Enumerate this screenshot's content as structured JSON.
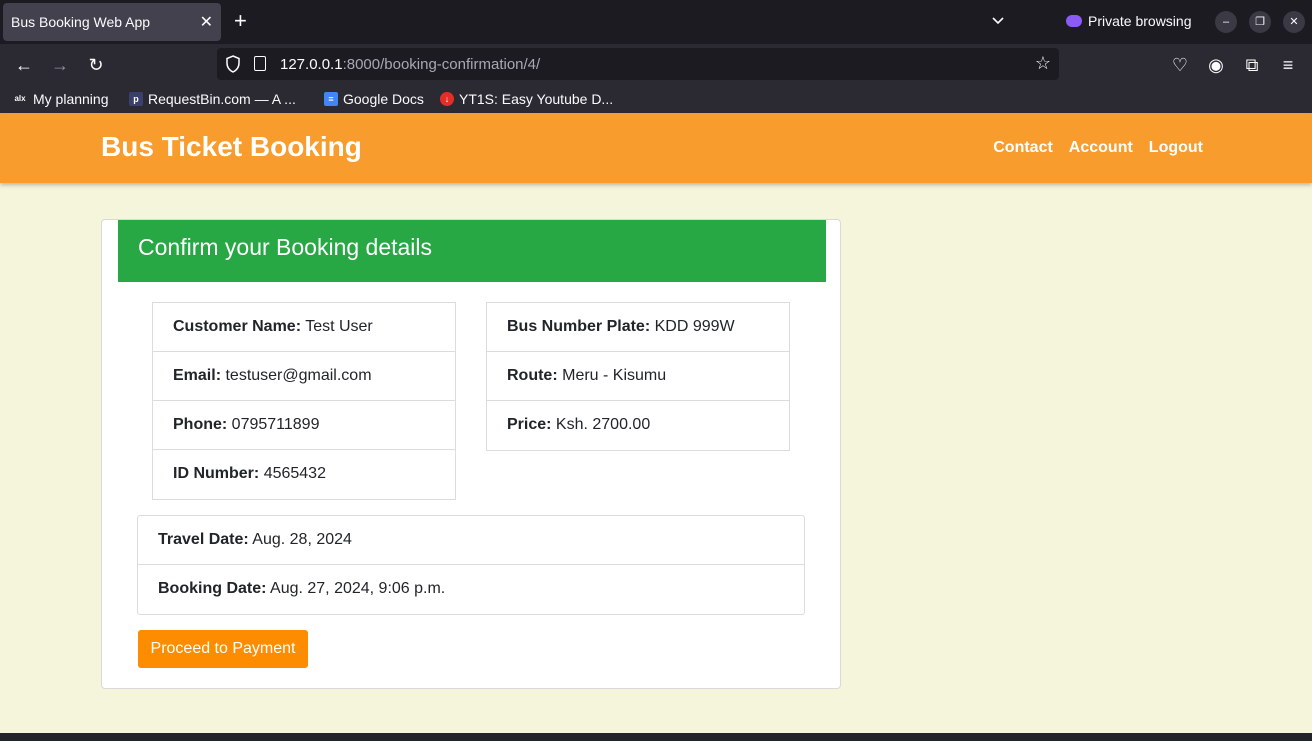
{
  "browser": {
    "tab_title": "Bus Booking Web App",
    "private_label": "Private browsing",
    "url_host": "127.0.0.1",
    "url_path": ":8000/booking-confirmation/4/",
    "bookmarks": [
      {
        "label": "My planning",
        "icon": "alx-icon"
      },
      {
        "label": "RequestBin.com — A ...",
        "icon": "requestbin-icon"
      },
      {
        "label": "Google Docs",
        "icon": "google-docs-icon"
      },
      {
        "label": "YT1S: Easy Youtube D...",
        "icon": "yt1s-icon"
      }
    ]
  },
  "site": {
    "brand": "Bus Ticket Booking",
    "nav": [
      "Contact",
      "Account",
      "Logout"
    ],
    "header_color": "#f89c2e"
  },
  "card": {
    "title": "Confirm your Booking details",
    "customer": [
      {
        "label": "Customer Name:",
        "value": "Test User"
      },
      {
        "label": "Email:",
        "value": "testuser@gmail.com"
      },
      {
        "label": "Phone:",
        "value": "0795711899"
      },
      {
        "label": "ID Number:",
        "value": "4565432"
      }
    ],
    "bus": [
      {
        "label": "Bus Number Plate:",
        "value": "KDD 999W"
      },
      {
        "label": "Route:",
        "value": "Meru - Kisumu"
      },
      {
        "label": "Price:",
        "value": "Ksh. 2700.00"
      }
    ],
    "dates": [
      {
        "label": "Travel Date:",
        "value": "Aug. 28, 2024"
      },
      {
        "label": "Booking Date:",
        "value": "Aug. 27, 2024, 9:06 p.m."
      }
    ],
    "button_label": "Proceed to Payment"
  }
}
